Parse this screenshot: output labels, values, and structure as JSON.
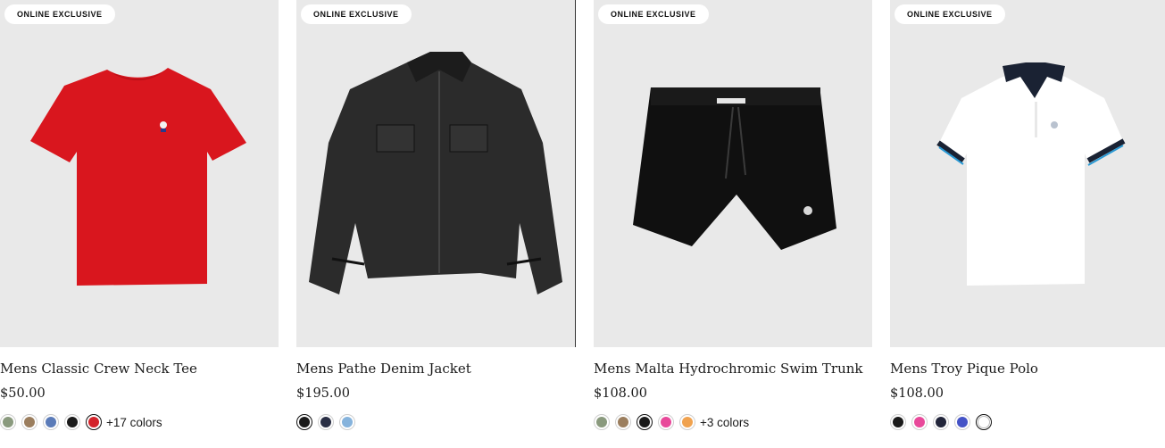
{
  "products": [
    {
      "badge": "ONLINE EXCLUSIVE",
      "name": "Mens Classic Crew Neck Tee",
      "price": "$50.00",
      "image_icon": "red-tshirt-image",
      "swatches": [
        {
          "color": "#8a9a7e",
          "selected": false
        },
        {
          "color": "#9b7e5e",
          "selected": false
        },
        {
          "color": "#5b7bb8",
          "selected": false
        },
        {
          "color": "#1b1b1b",
          "selected": false
        },
        {
          "color": "#d3242b",
          "selected": true
        }
      ],
      "more_colors": "+17 colors"
    },
    {
      "badge": "ONLINE EXCLUSIVE",
      "name": "Mens Pathe Denim Jacket",
      "price": "$195.00",
      "image_icon": "black-denim-jacket-image",
      "swatches": [
        {
          "color": "#1a1a1a",
          "selected": true
        },
        {
          "color": "#2a2f45",
          "selected": false
        },
        {
          "color": "#86b3dc",
          "selected": false
        }
      ],
      "more_colors": ""
    },
    {
      "badge": "ONLINE EXCLUSIVE",
      "name": "Mens Malta Hydrochromic Swim Trunk",
      "price": "$108.00",
      "image_icon": "black-swim-trunk-image",
      "swatches": [
        {
          "color": "#8a9a7e",
          "selected": false
        },
        {
          "color": "#9b7e5e",
          "selected": false
        },
        {
          "color": "#1a1a1a",
          "selected": true
        },
        {
          "color": "#e8499a",
          "selected": false
        },
        {
          "color": "#f0a24f",
          "selected": false
        }
      ],
      "more_colors": "+3 colors"
    },
    {
      "badge": "ONLINE EXCLUSIVE",
      "name": "Mens Troy Pique Polo",
      "price": "$108.00",
      "image_icon": "white-polo-image",
      "swatches": [
        {
          "color": "#1a1a1a",
          "selected": false
        },
        {
          "color": "#e8499a",
          "selected": false
        },
        {
          "color": "#22253a",
          "selected": false
        },
        {
          "color": "#4453c6",
          "selected": false
        },
        {
          "color": "#ffffff",
          "selected": true
        }
      ],
      "more_colors": ""
    }
  ]
}
